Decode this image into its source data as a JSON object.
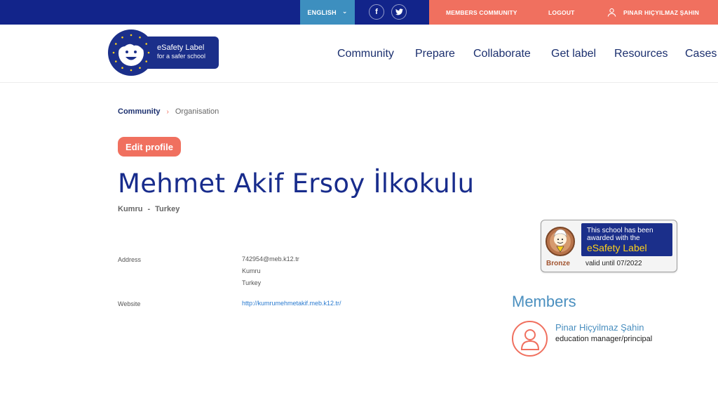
{
  "topbar": {
    "language": "ENGLISH",
    "members_community": "MEMBERS COMMUNITY",
    "logout": "LOGOUT",
    "user_name": "PINAR HIÇYILMAZ ŞAHIN",
    "facebook_glyph": "f",
    "language_icon": "chevron-down-icon",
    "user_icon": "user-icon"
  },
  "logo": {
    "line1": "eSafety Label",
    "line2": "for a safer school"
  },
  "nav": [
    "Community",
    "Prepare",
    "Collaborate",
    "Get label",
    "Resources",
    "Cases"
  ],
  "breadcrumb": {
    "link": "Community",
    "current": "Organisation"
  },
  "edit_profile": "Edit profile",
  "school": {
    "name": "Mehmet Akif Ersoy İlkokulu",
    "city": "Kumru",
    "separator": "-",
    "country": "Turkey"
  },
  "details": {
    "address_label": "Address",
    "address_lines": [
      "742954@meb.k12.tr",
      "Kumru",
      "Turkey"
    ],
    "website_label": "Website",
    "website": "http://kumrumehmetakif.meb.k12.tr/"
  },
  "badge": {
    "line1": "This school has been awarded with the",
    "line2": "eSafety Label",
    "level": "Bronze",
    "valid": "valid until 07/2022"
  },
  "members": {
    "title": "Members",
    "items": [
      {
        "name": "Pinar Hiçyilmaz Şahin",
        "role": "education manager/principal"
      }
    ]
  },
  "colors": {
    "navy": "#12248a",
    "coral": "#f0705f",
    "blue": "#3d8fbf",
    "title": "#182c8c"
  }
}
